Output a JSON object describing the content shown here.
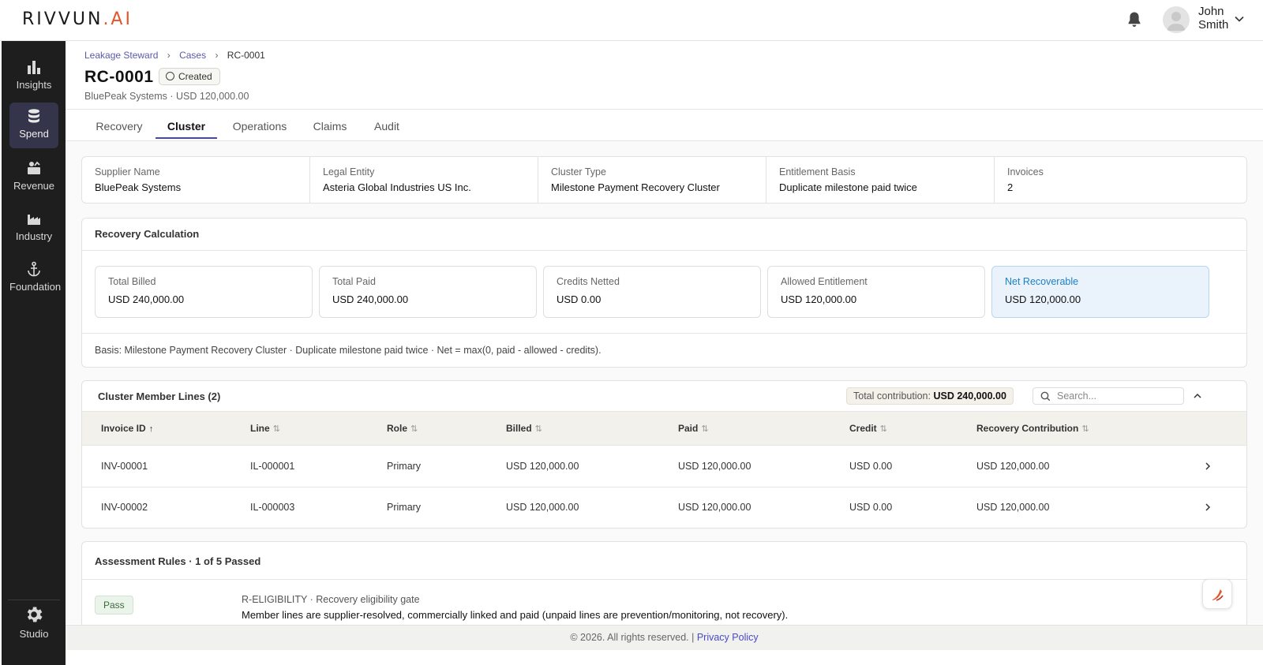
{
  "brand": {
    "logo_main": "RIVVUN",
    "logo_suffix": ".AI",
    "accent": "#e6542a"
  },
  "header": {
    "user_first": "John",
    "user_last": "Smith"
  },
  "sidebar": {
    "items": [
      {
        "label": "Insights",
        "icon": "bar-chart-icon",
        "active": false
      },
      {
        "label": "Spend",
        "icon": "database-icon",
        "active": true
      },
      {
        "label": "Revenue",
        "icon": "revenue-icon",
        "active": false
      },
      {
        "label": "Industry",
        "icon": "factory-icon",
        "active": false
      },
      {
        "label": "Foundation",
        "icon": "anchor-icon",
        "active": false
      }
    ],
    "bottom": {
      "label": "Studio",
      "icon": "gear-icon"
    }
  },
  "breadcrumb": {
    "items": [
      "Leakage Steward",
      "Cases"
    ],
    "current": "RC-0001"
  },
  "case": {
    "id": "RC-0001",
    "status": "Created",
    "subtitle": "BluePeak Systems · USD 120,000.00"
  },
  "tabs": [
    "Recovery",
    "Cluster",
    "Operations",
    "Claims",
    "Audit"
  ],
  "active_tab": "Cluster",
  "summary": [
    {
      "label": "Supplier Name",
      "value": "BluePeak Systems"
    },
    {
      "label": "Legal Entity",
      "value": "Asteria Global Industries US Inc."
    },
    {
      "label": "Cluster Type",
      "value": "Milestone Payment Recovery Cluster"
    },
    {
      "label": "Entitlement Basis",
      "value": "Duplicate milestone paid twice"
    },
    {
      "label": "Invoices",
      "value": "2"
    }
  ],
  "recovery": {
    "title": "Recovery Calculation",
    "metrics": [
      {
        "label": "Total Billed",
        "value": "USD 240,000.00"
      },
      {
        "label": "Total Paid",
        "value": "USD 240,000.00"
      },
      {
        "label": "Credits Netted",
        "value": "USD 0.00"
      },
      {
        "label": "Allowed Entitlement",
        "value": "USD 120,000.00"
      },
      {
        "label": "Net Recoverable",
        "value": "USD 120,000.00"
      }
    ],
    "basis": "Basis: Milestone Payment Recovery Cluster · Duplicate milestone paid twice · Net = max(0, paid - allowed - credits)."
  },
  "lines": {
    "title": "Cluster Member Lines (2)",
    "contribution_label": "Total contribution:",
    "contribution_value": "USD 240,000.00",
    "search_placeholder": "Search...",
    "columns": [
      "Invoice ID",
      "Line",
      "Role",
      "Billed",
      "Paid",
      "Credit",
      "Recovery Contribution"
    ],
    "rows": [
      [
        "INV-00001",
        "IL-000001",
        "Primary",
        "USD 120,000.00",
        "USD 120,000.00",
        "USD 0.00",
        "USD 120,000.00"
      ],
      [
        "INV-00002",
        "IL-000003",
        "Primary",
        "USD 120,000.00",
        "USD 120,000.00",
        "USD 0.00",
        "USD 120,000.00"
      ]
    ]
  },
  "rules": {
    "title": "Assessment Rules · 1 of 5 Passed",
    "items": [
      {
        "status": "Pass",
        "code": "R-ELIGIBILITY · Recovery eligibility gate",
        "description": "Member lines are supplier-resolved, commercially linked and paid (unpaid lines are prevention/monitoring, not recovery)."
      }
    ]
  },
  "footer": {
    "copyright": "© 2026. All rights reserved. |",
    "link": "Privacy Policy"
  }
}
